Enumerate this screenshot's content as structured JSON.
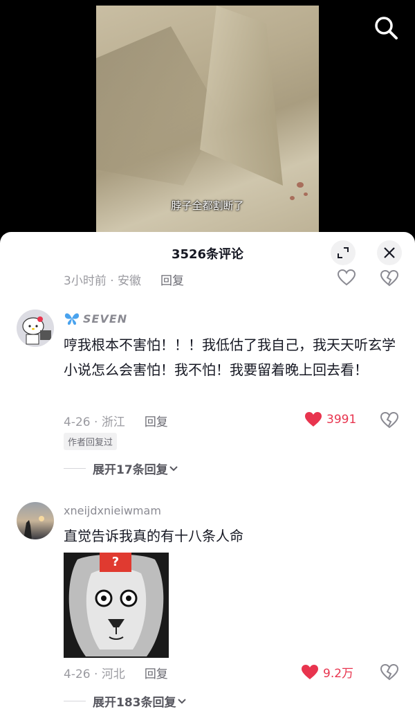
{
  "video": {
    "subtitle": "脖子全都割断了"
  },
  "sheet": {
    "title": "3526条评论"
  },
  "top_partial": {
    "time": "3小时前",
    "location": "安徽",
    "reply_label": "回复"
  },
  "comments": [
    {
      "username": "SEVEN",
      "text": "哼我根本不害怕！！！我低估了我自己，我天天听玄学小说怎么会害怕！我不怕！我要留着晚上回去看！",
      "date": "4-26",
      "location": "浙江",
      "reply_label": "回复",
      "likes": "3991",
      "badge": "作者回复过",
      "expand_label": "展开17条回复"
    },
    {
      "username": "xneijdxnieiwmam",
      "text": "直觉告诉我真的有十八条人命",
      "image_badge": "?",
      "date": "4-26",
      "location": "河北",
      "reply_label": "回复",
      "likes": "9.2万",
      "expand_label": "展开183条回复"
    }
  ],
  "colors": {
    "like_red": "#e8344e",
    "text_primary": "#161823",
    "text_secondary": "#9a9aa0"
  },
  "icons": [
    "search-icon",
    "expand-icon",
    "close-icon",
    "heart-icon",
    "dislike-icon",
    "butterfly-icon",
    "chevron-down-icon"
  ]
}
